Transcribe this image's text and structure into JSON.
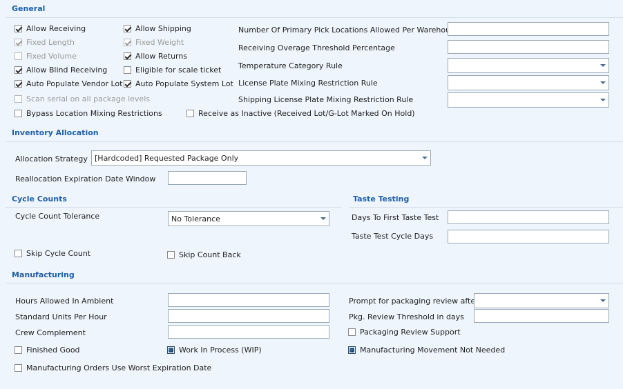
{
  "general": {
    "title": "General",
    "checkboxes": {
      "allow_receiving": {
        "label": "Allow Receiving",
        "checked": true
      },
      "fixed_length": {
        "label": "Fixed Length",
        "checked": true,
        "disabled": true
      },
      "fixed_volume": {
        "label": "Fixed Volume",
        "checked": false,
        "disabled": true
      },
      "allow_blind_receiving": {
        "label": "Allow Blind Receiving",
        "checked": true
      },
      "auto_populate_vendor_lot": {
        "label": "Auto Populate Vendor Lot",
        "checked": true
      },
      "scan_serial": {
        "label": "Scan serial on all package levels",
        "checked": false,
        "disabled": true
      },
      "bypass_location_mixing": {
        "label": "Bypass Location Mixing Restrictions",
        "checked": false
      },
      "allow_shipping": {
        "label": "Allow Shipping",
        "checked": true
      },
      "fixed_weight": {
        "label": "Fixed Weight",
        "checked": true,
        "disabled": true
      },
      "allow_returns": {
        "label": "Allow Returns",
        "checked": true
      },
      "eligible_scale_ticket": {
        "label": "Eligible for scale ticket",
        "checked": false
      },
      "auto_populate_system_lot": {
        "label": "Auto Populate System Lot",
        "checked": true
      },
      "receive_as_inactive": {
        "label": "Receive as Inactive (Received Lot/G-Lot Marked On Hold)",
        "checked": false
      }
    },
    "fields": {
      "primary_pick_locations": {
        "label": "Number Of Primary Pick Locations Allowed Per Warehouse",
        "value": ""
      },
      "receiving_overage": {
        "label": "Receiving Overage Threshold Percentage",
        "value": ""
      },
      "temperature_category": {
        "label": "Temperature Category Rule",
        "value": ""
      },
      "license_plate_mixing": {
        "label": "License Plate Mixing Restriction Rule",
        "value": ""
      },
      "shipping_license_plate": {
        "label": "Shipping License Plate Mixing Restriction Rule",
        "value": ""
      }
    }
  },
  "inventory_allocation": {
    "title": "Inventory Allocation",
    "allocation_strategy": {
      "label": "Allocation Strategy",
      "value": "[Hardcoded] Requested Package Only"
    },
    "reallocation_window": {
      "label": "Reallocation Expiration Date Window",
      "value": ""
    }
  },
  "cycle_counts": {
    "title": "Cycle Counts",
    "tolerance": {
      "label": "Cycle Count Tolerance",
      "value": "No Tolerance"
    },
    "skip_cycle_count": {
      "label": "Skip Cycle Count",
      "checked": false
    },
    "skip_count_back": {
      "label": "Skip Count Back",
      "checked": false
    }
  },
  "taste_testing": {
    "title": "Taste Testing",
    "days_to_first": {
      "label": "Days To First Taste Test",
      "value": ""
    },
    "cycle_days": {
      "label": "Taste Test Cycle Days",
      "value": ""
    }
  },
  "manufacturing": {
    "title": "Manufacturing",
    "hours_ambient": {
      "label": "Hours Allowed In Ambient",
      "value": ""
    },
    "standard_units": {
      "label": "Standard Units Per Hour",
      "value": ""
    },
    "crew_complement": {
      "label": "Crew Complement",
      "value": ""
    },
    "prompt_packaging": {
      "label": "Prompt for packaging review after",
      "value": ""
    },
    "review_threshold": {
      "label": "Pkg. Review Threshold in days",
      "value": ""
    },
    "packaging_review_support": {
      "label": "Packaging Review Support",
      "checked": false
    },
    "finished_good": {
      "label": "Finished Good",
      "checked": false
    },
    "work_in_process": {
      "label": "Work In Process (WIP)",
      "checked": true
    },
    "movement_not_needed": {
      "label": "Manufacturing Movement Not Needed",
      "checked": true
    },
    "worst_expiration": {
      "label": "Manufacturing Orders Use Worst Expiration Date",
      "checked": false
    }
  }
}
